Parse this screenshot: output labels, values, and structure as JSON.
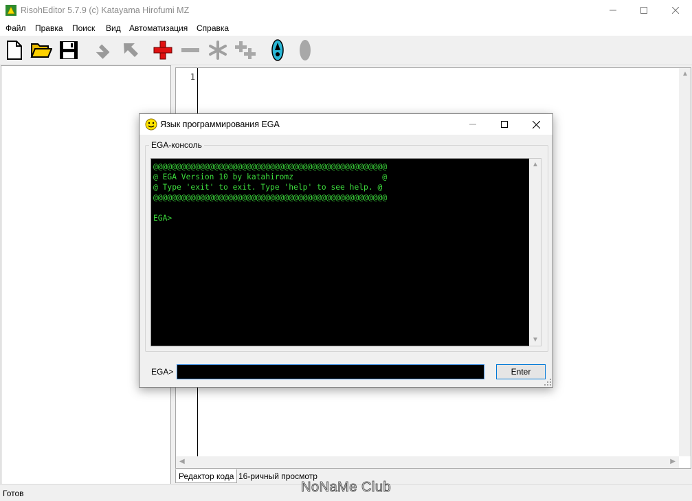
{
  "window": {
    "title": "RisohEditor 5.7.9 (c) Katayama Hirofumi MZ",
    "icon": "risoh-app-icon"
  },
  "menu": [
    "Файл",
    "Правка",
    "Поиск",
    "Вид",
    "Автоматизация",
    "Справка"
  ],
  "toolbar": {
    "icons": [
      "new-file-icon",
      "open-folder-icon",
      "save-icon",
      "move-down-icon",
      "move-up-icon",
      "add-icon",
      "remove-icon",
      "modify-icon",
      "clone-icon",
      "test-run-icon",
      "disabled-oval-icon"
    ]
  },
  "editor": {
    "line_number": "1"
  },
  "tabs": [
    "Редактор кода",
    "16-ричный просмотр"
  ],
  "status": {
    "text": "Готов"
  },
  "watermark": "NoNaMe Club",
  "dialog": {
    "title": "Язык программирования EGA",
    "icon": "smiley-icon",
    "group_label": "EGA-консоль",
    "console_lines": [
      "@@@@@@@@@@@@@@@@@@@@@@@@@@@@@@@@@@@@@@@@@@@@@@@@@@",
      "@ EGA Version 10 by katahiromz                   @",
      "@ Type 'exit' to exit. Type 'help' to see help. @",
      "@@@@@@@@@@@@@@@@@@@@@@@@@@@@@@@@@@@@@@@@@@@@@@@@@@",
      "",
      "EGA>"
    ],
    "prompt_label": "EGA>",
    "input_value": "",
    "enter_label": "Enter"
  },
  "colors": {
    "console_text": "#3cdc3c",
    "console_bg": "#000000",
    "accent": "#0078d7"
  }
}
